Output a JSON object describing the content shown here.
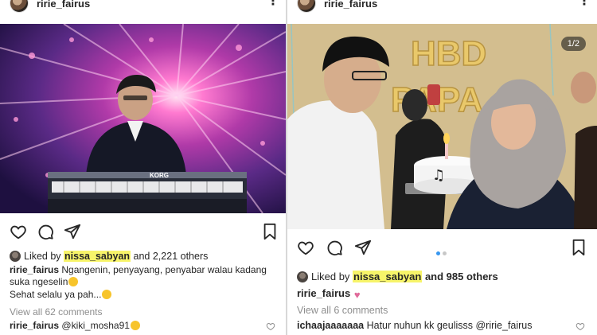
{
  "left": {
    "username": "ririe_fairus",
    "liked_prefix": "Liked by",
    "liked_user": "nissa_sabyan",
    "liked_suffix": "and 2,221 others",
    "caption_user": "ririe_fairus",
    "caption_text": "Ngangenin, penyayang, penyabar walau kadang suka ngeselin",
    "caption_line2": "Sehat selalu ya pah...",
    "view_all": "View all 62 comments",
    "comment_user": "ririe_fairus",
    "comment_text": "@kiki_mosha91",
    "keyboard_brand": "KORG"
  },
  "right": {
    "username": "ririe_fairus",
    "carousel_badge": "1/2",
    "liked_prefix": "Liked by",
    "liked_user": "nissa_sabyan",
    "liked_suffix": "and 985 others",
    "caption_user": "ririe_fairus",
    "view_all": "View all 6 comments",
    "comment_user": "ichaajaaaaaaa",
    "comment_text": "Hatur nuhun kk geulisss @ririe_fairus",
    "balloon_text": "HBD PAPA"
  },
  "icons": {
    "more": "more-icon",
    "heart": "heart-icon",
    "comment": "comment-icon",
    "share": "share-icon",
    "bookmark": "bookmark-icon"
  },
  "colors": {
    "highlight": "#f7f46a",
    "carousel_active_dot": "#3897f0",
    "muted_text": "#8e8e8e"
  }
}
